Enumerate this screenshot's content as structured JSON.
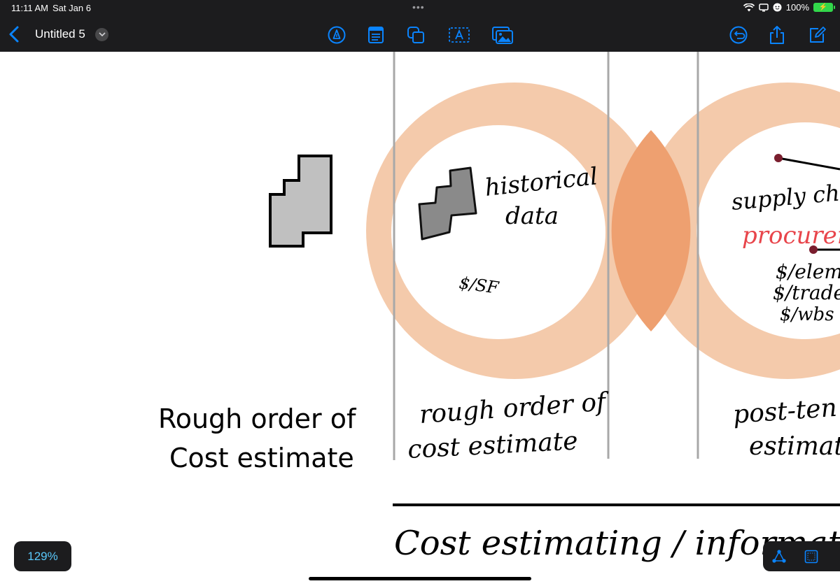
{
  "status_bar": {
    "time": "11:11 AM",
    "date": "Sat Jan 6",
    "battery": "100%"
  },
  "toolbar": {
    "title": "Untitled 5",
    "tools": [
      "pen-tool-icon",
      "note-icon",
      "shapes-icon",
      "text-box-icon",
      "image-icon"
    ],
    "right": [
      "undo-icon",
      "share-icon",
      "edit-icon"
    ]
  },
  "canvas": {
    "typed_label_line1": "Rough order of",
    "typed_label_line2": "Cost estimate",
    "note_historical_1": "historical",
    "note_historical_2": "data",
    "note_sf": "$/SF",
    "label_rough_1": "rough order of",
    "label_rough_2": "cost estimate",
    "note_supply": "supply cha",
    "note_procurement": "procureme",
    "note_elem": "$/elem",
    "note_trade": "$/trade",
    "note_wbs": "$/wbs",
    "label_post_1": "post-ten",
    "label_post_2": "estimat",
    "footer_text": "Cost estimating / information s",
    "colors": {
      "circle": "#f0b088",
      "overlap": "#eea070",
      "procurement": "#e8454b",
      "dot": "#7a1e2e"
    }
  },
  "zoom": {
    "level": "129%"
  }
}
